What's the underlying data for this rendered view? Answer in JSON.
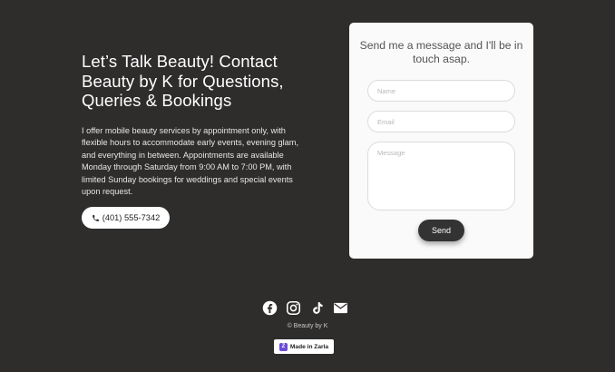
{
  "contact": {
    "heading": "Let’s Talk Beauty! Contact Beauty by K for Questions, Queries & Bookings",
    "intro": "I offer mobile beauty services by appointment only, with flexible hours to accommodate early events, evening glam, and everything in between. Appointments are available Monday through Saturday from 9:00 AM to 7:00 PM, with limited Sunday bookings for weddings and special events upon request.",
    "phone_label": "(401) 555-7342"
  },
  "form": {
    "title": "Send me a message and I'll be in touch asap.",
    "name_placeholder": "Name",
    "email_placeholder": "Email",
    "message_placeholder": "Message",
    "send_label": "Send"
  },
  "footer": {
    "social_icons": [
      "facebook-icon",
      "instagram-icon",
      "tiktok-icon",
      "mail-icon"
    ],
    "copyright": "© Beauty by K",
    "badge_label": "Made in Zarla",
    "badge_color": "#6c4bd8"
  },
  "colors": {
    "background": "#2f2c2c",
    "card": "#fafafa",
    "button_dark": "#333333"
  }
}
